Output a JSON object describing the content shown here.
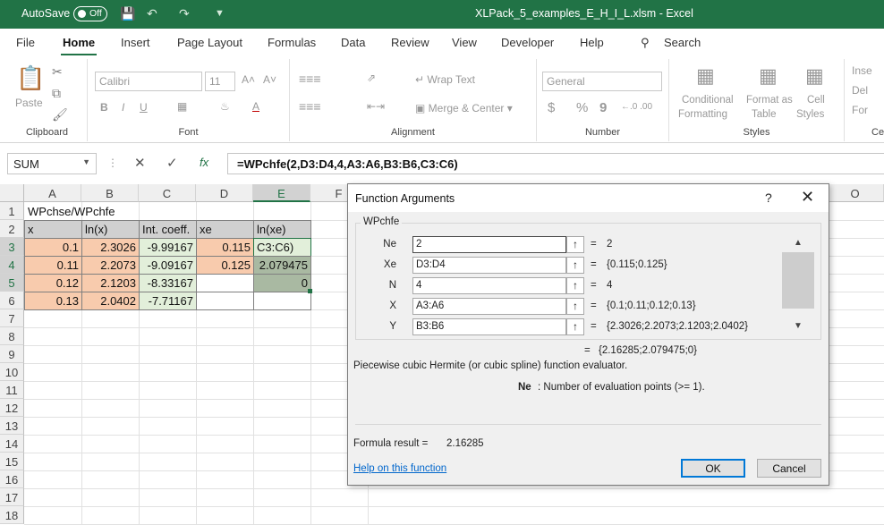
{
  "titlebar": {
    "autosave_label": "AutoSave",
    "autosave_state": "Off",
    "filename": "XLPack_5_examples_E_H_I_L.xlsm",
    "separator": "-",
    "app": "Excel"
  },
  "tabs": [
    "File",
    "Home",
    "Insert",
    "Page Layout",
    "Formulas",
    "Data",
    "Review",
    "View",
    "Developer",
    "Help"
  ],
  "search_label": "Search",
  "ribbon": {
    "clipboard": {
      "paste": "Paste",
      "group": "Clipboard"
    },
    "font": {
      "font_name": "Calibri",
      "font_size": "11",
      "bold": "B",
      "italic": "I",
      "underline": "U",
      "group": "Font"
    },
    "alignment": {
      "wrap_text": "Wrap Text",
      "merge_center": "Merge & Center",
      "group": "Alignment"
    },
    "number": {
      "format": "General",
      "currency": "$",
      "percent": "%",
      "comma": "9",
      "group": "Number"
    },
    "styles": {
      "conditional_formatting_1": "Conditional",
      "conditional_formatting_2": "Formatting",
      "format_as_table_1": "Format as",
      "format_as_table_2": "Table",
      "cell_styles_1": "Cell",
      "cell_styles_2": "Styles",
      "group": "Styles"
    },
    "cells": {
      "insert": "Inse",
      "delete": "Del",
      "format": "For",
      "group": "Ce"
    }
  },
  "formula_bar": {
    "name_box": "SUM",
    "fx": "fx",
    "formula": "=WPchfe(2,D3:D4,4,A3:A6,B3:B6,C3:C6)"
  },
  "grid": {
    "columns": [
      "A",
      "B",
      "C",
      "D",
      "E",
      "F",
      "O"
    ],
    "rows": [
      "1",
      "2",
      "3",
      "4",
      "5",
      "6",
      "7",
      "8",
      "9",
      "10",
      "11",
      "12",
      "13",
      "14",
      "15",
      "16",
      "17",
      "18"
    ],
    "title": "WPchse/WPchfe",
    "headers": [
      "x",
      "ln(x)",
      "Int. coeff.",
      "xe",
      "ln(xe)"
    ],
    "x": [
      "0.1",
      "0.11",
      "0.12",
      "0.13"
    ],
    "lnx": [
      "2.3026",
      "2.2073",
      "2.1203",
      "2.0402"
    ],
    "coeff": [
      "-9.99167",
      "-9.09167",
      "-8.33167",
      "-7.71167"
    ],
    "xe": [
      "0.115",
      "0.125"
    ],
    "lnxe": [
      "C3:C6)",
      "2.079475",
      "0"
    ]
  },
  "dialog": {
    "title": "Function Arguments",
    "help_q": "?",
    "close": "✕",
    "function_name": "WPchfe",
    "args": [
      {
        "label": "Ne",
        "value": "2",
        "result": "2"
      },
      {
        "label": "Xe",
        "value": "D3:D4",
        "result": "{0.115;0.125}"
      },
      {
        "label": "N",
        "value": "4",
        "result": "4"
      },
      {
        "label": "X",
        "value": "A3:A6",
        "result": "{0.1;0.11;0.12;0.13}"
      },
      {
        "label": "Y",
        "value": "B3:B6",
        "result": "{2.3026;2.2073;2.1203;2.0402}"
      }
    ],
    "eq": "=",
    "overall_result": "{2.16285;2.079475;0}",
    "description": "Piecewise cubic Hermite (or cubic spline) function evaluator.",
    "arg_name": "Ne",
    "arg_desc": ": Number of evaluation points (>= 1).",
    "formula_result_label": "Formula result =",
    "formula_result_value": "2.16285",
    "help_link": "Help on this function",
    "ok": "OK",
    "cancel": "Cancel"
  },
  "colors": {
    "excel_green": "#217346",
    "salmon": "#f8cbad",
    "light_green": "#e2efda",
    "link": "#0066cc"
  }
}
